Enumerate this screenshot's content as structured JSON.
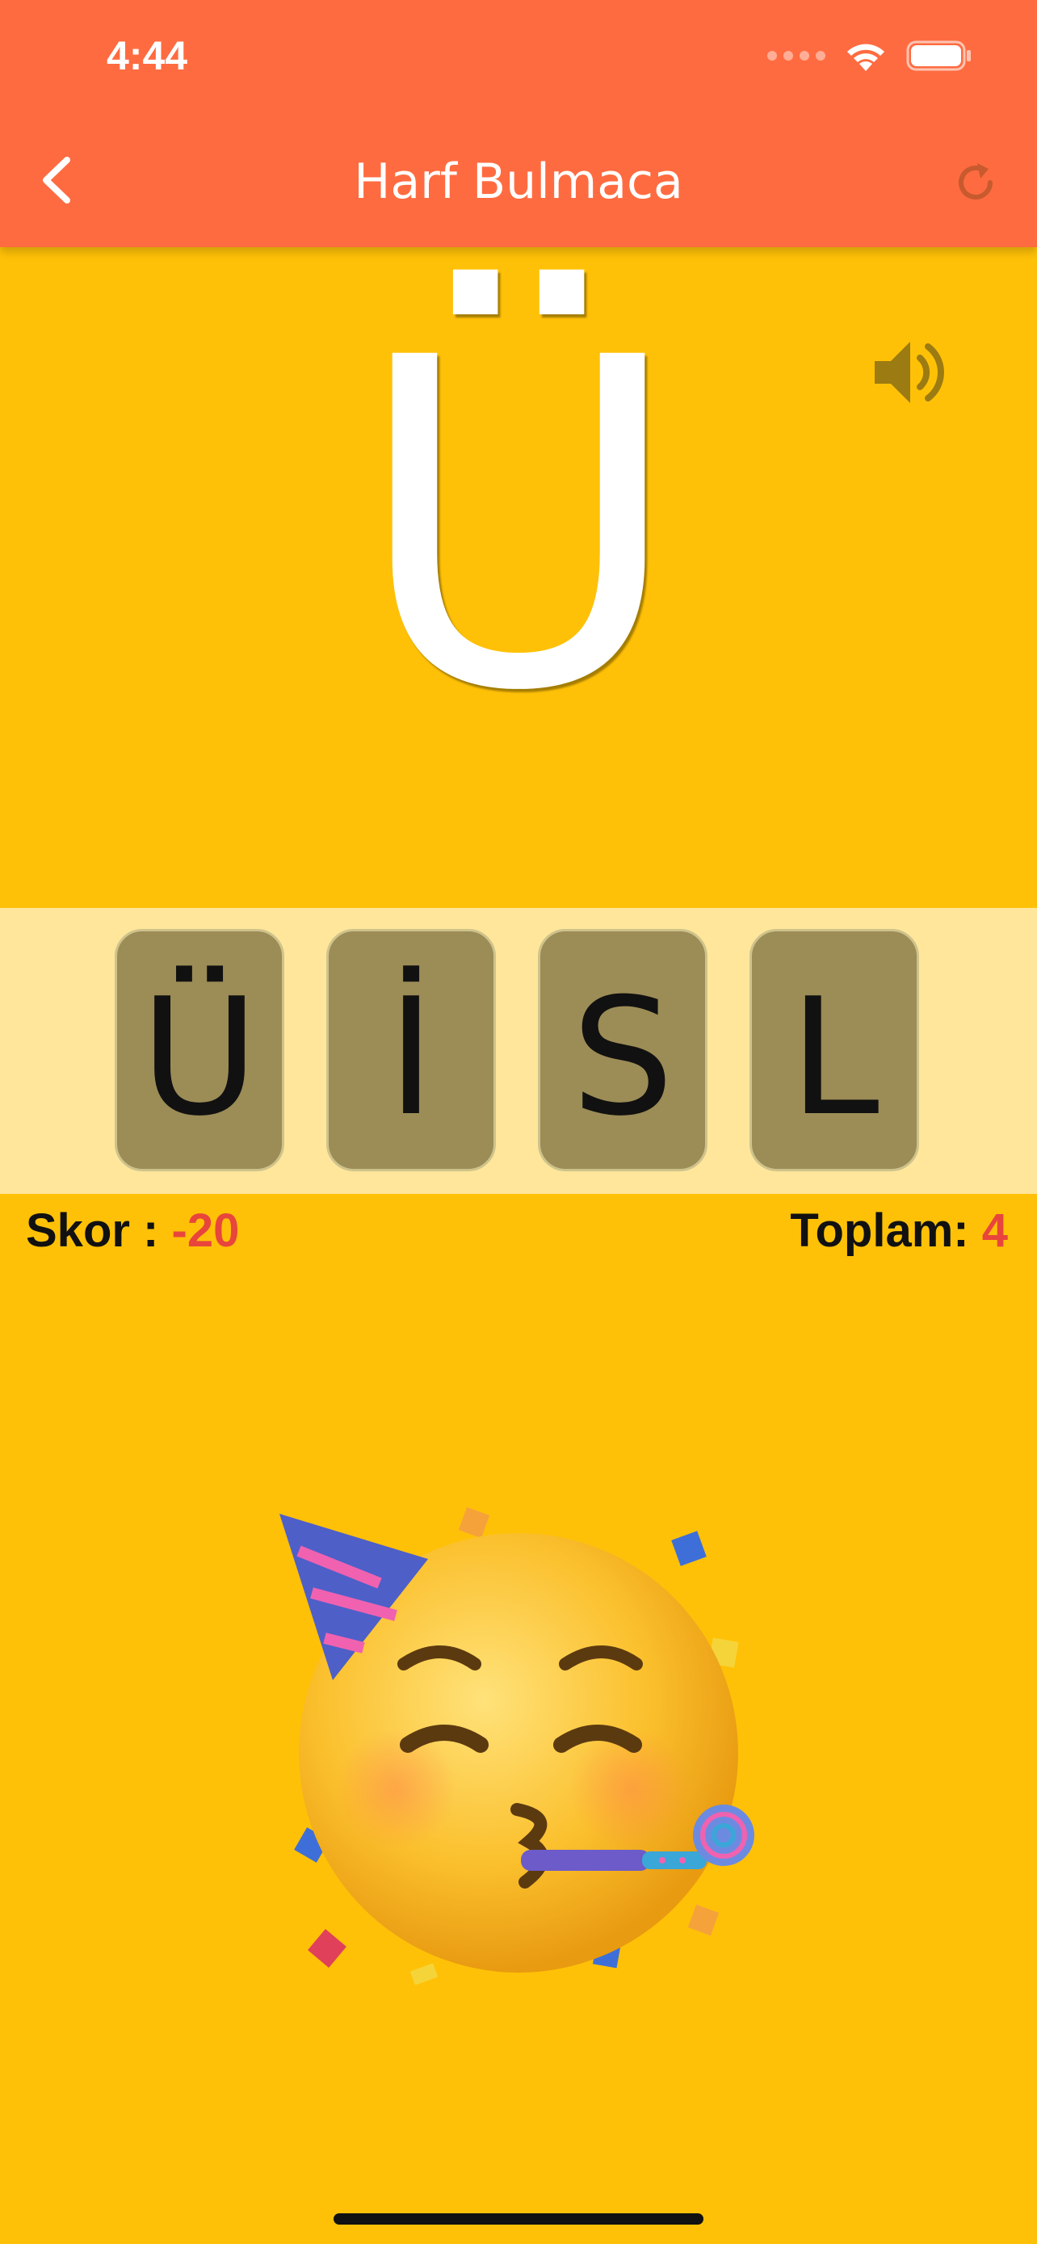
{
  "status_bar": {
    "time": "4:44",
    "icons": [
      "cellular-dots-icon",
      "wifi-icon",
      "battery-icon"
    ]
  },
  "header": {
    "title": "Harf Bulmaca",
    "back_icon": "chevron-left-icon",
    "refresh_icon": "refresh-icon",
    "background_color": "#FF6B40"
  },
  "main": {
    "big_letter": "Ü",
    "sound_icon": "speaker-icon",
    "background_color": "#FFC107"
  },
  "tiles": [
    {
      "letter": "Ü"
    },
    {
      "letter": "İ"
    },
    {
      "letter": "S"
    },
    {
      "letter": "L"
    }
  ],
  "score": {
    "skor_label": "Skor : ",
    "skor_value": "-20",
    "toplam_label": "Toplam: ",
    "toplam_value": "4",
    "value_color": "#E8453C"
  },
  "celebration": {
    "icon": "party-face-emoji-icon"
  }
}
